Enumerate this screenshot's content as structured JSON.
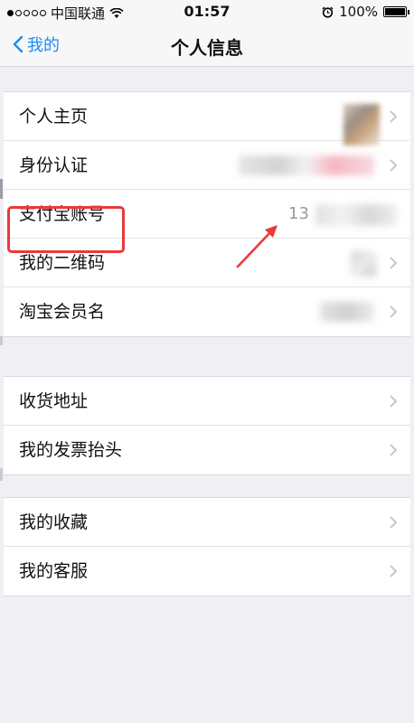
{
  "status_bar": {
    "carrier": "中国联通",
    "time": "01:57",
    "battery": "100%"
  },
  "nav": {
    "back_label": "我的",
    "title": "个人信息"
  },
  "groups": [
    {
      "rows": [
        {
          "label": "个人主页"
        },
        {
          "label": "身份认证"
        },
        {
          "label": "支付宝账号",
          "value": "13"
        },
        {
          "label": "我的二维码"
        },
        {
          "label": "淘宝会员名"
        }
      ]
    },
    {
      "rows": [
        {
          "label": "收货地址"
        },
        {
          "label": "我的发票抬头"
        }
      ]
    },
    {
      "rows": [
        {
          "label": "我的收藏"
        },
        {
          "label": "我的客服"
        }
      ]
    }
  ],
  "colors": {
    "accent": "#1a8cf5",
    "annotation": "#e83a3a",
    "background": "#efeff4"
  }
}
